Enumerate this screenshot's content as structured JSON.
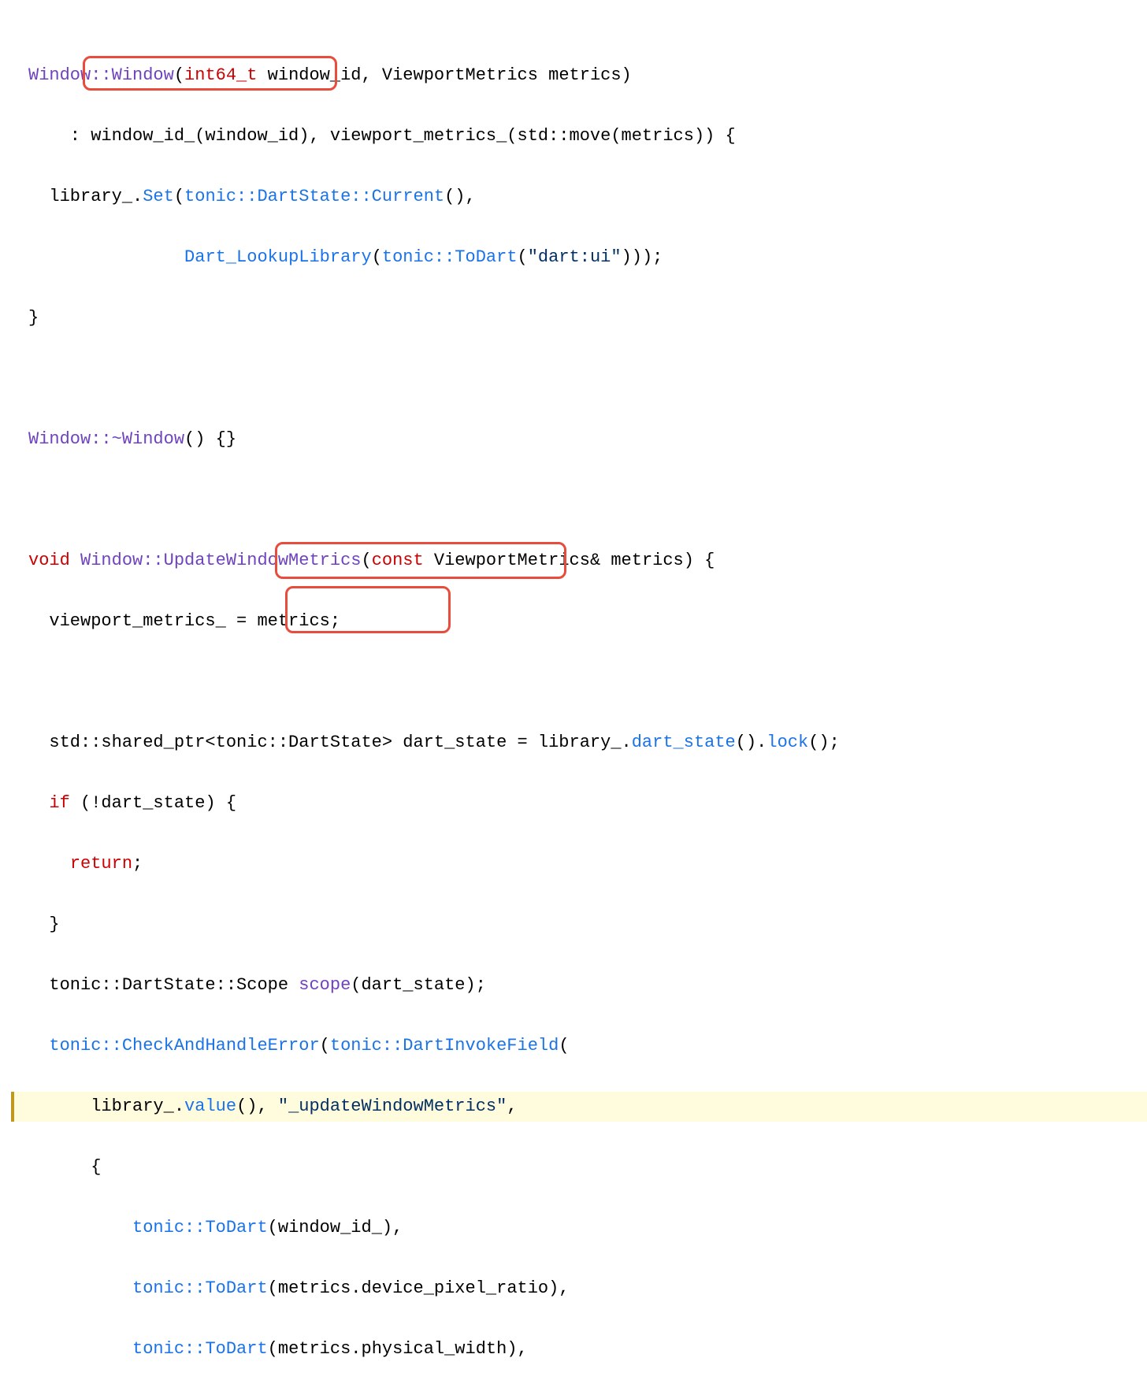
{
  "code": {
    "line1": {
      "a": "Window::Window",
      "b": "(",
      "c": "int64_t",
      "d": " window_id, ViewportMetrics metrics)"
    },
    "line2": {
      "a": "    : window_id_(window_id), viewport_metrics_(std::move(metrics)) {"
    },
    "line3": {
      "a": "  library_.",
      "b": "Set",
      "c": "(",
      "d": "tonic::DartState::Current",
      "e": "(),"
    },
    "line4": {
      "a": "               ",
      "b": "Dart_LookupLibrary",
      "c": "(",
      "d": "tonic::ToDart",
      "e": "(",
      "f": "\"dart:ui\"",
      "g": ")));"
    },
    "line5": {
      "a": "}"
    },
    "line7": {
      "a": "Window::~Window",
      "b": "() {}"
    },
    "line9": {
      "a": "void",
      "b": " ",
      "c": "Window::UpdateWindowMetrics",
      "d": "(",
      "e": "const",
      "f": " ViewportMetrics& metrics) {"
    },
    "line10": {
      "a": "  viewport_metrics_ = metrics;"
    },
    "line12": {
      "a": "  std::shared_ptr<tonic::DartState> dart_state = library_.",
      "b": "dart_state",
      "c": "().",
      "d": "lock",
      "e": "();"
    },
    "line13": {
      "a": "  ",
      "b": "if",
      "c": " (!dart_state) {"
    },
    "line14": {
      "a": "    ",
      "b": "return",
      "c": ";"
    },
    "line15": {
      "a": "  }"
    },
    "line16": {
      "a": "  tonic::DartState::Scope ",
      "b": "scope",
      "c": "(dart_state);"
    },
    "line17": {
      "a": "  ",
      "b": "tonic::CheckAndHandleError",
      "c": "(",
      "d": "tonic::DartInvokeField",
      "e": "("
    },
    "line18": {
      "a": "      library_.",
      "b": "value",
      "c": "(), ",
      "d": "\"_updateWindowMetrics\"",
      "e": ","
    },
    "line19": {
      "a": "      {"
    },
    "line20": {
      "a": "          ",
      "b": "tonic::ToDart",
      "c": "(window_id_),"
    },
    "line21": {
      "a": "          ",
      "b": "tonic::ToDart",
      "c": "(metrics.device_pixel_ratio),"
    },
    "line22": {
      "a": "          ",
      "b": "tonic::ToDart",
      "c": "(metrics.physical_width),"
    }
  },
  "annotations": {
    "box1_label": "window_id_(window_id)",
    "box2_label": "\"_updateWindowMetrics\",",
    "box3_label": "(window_id_),"
  }
}
